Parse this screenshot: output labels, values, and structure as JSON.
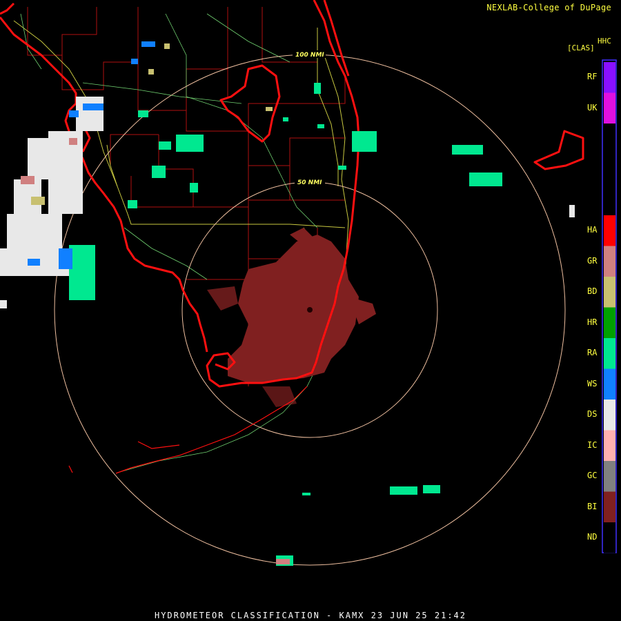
{
  "credit": "NEXLAB-College of DuPage",
  "product_code": "HHC",
  "product_type": "[CLAS]",
  "title": "HYDROMETEOR CLASSIFICATION - KAMX 23 JUN 25 21:42",
  "range_rings": [
    "100 NMI",
    "50 NMI"
  ],
  "legend": [
    {
      "code": "RF",
      "color": "#8a10ff"
    },
    {
      "code": "UK",
      "color": "#e010e0"
    },
    {
      "code": "HA",
      "color": "#ff0000"
    },
    {
      "code": "GR",
      "color": "#d08080"
    },
    {
      "code": "BD",
      "color": "#c8c070"
    },
    {
      "code": "HR",
      "color": "#00a000"
    },
    {
      "code": "RA",
      "color": "#00e890"
    },
    {
      "code": "WS",
      "color": "#1080ff"
    },
    {
      "code": "DS",
      "color": "#e8e8e8"
    },
    {
      "code": "IC",
      "color": "#ffb0b0"
    },
    {
      "code": "GC",
      "color": "#808080"
    },
    {
      "code": "BI",
      "color": "#802020"
    },
    {
      "code": "ND",
      "color": "#000000"
    }
  ],
  "colors": {
    "coast": "#ff1010",
    "county": "#b01010",
    "roads": "#c8c840",
    "ring": "#f0c0a0",
    "legend_border": "#4030ff"
  }
}
